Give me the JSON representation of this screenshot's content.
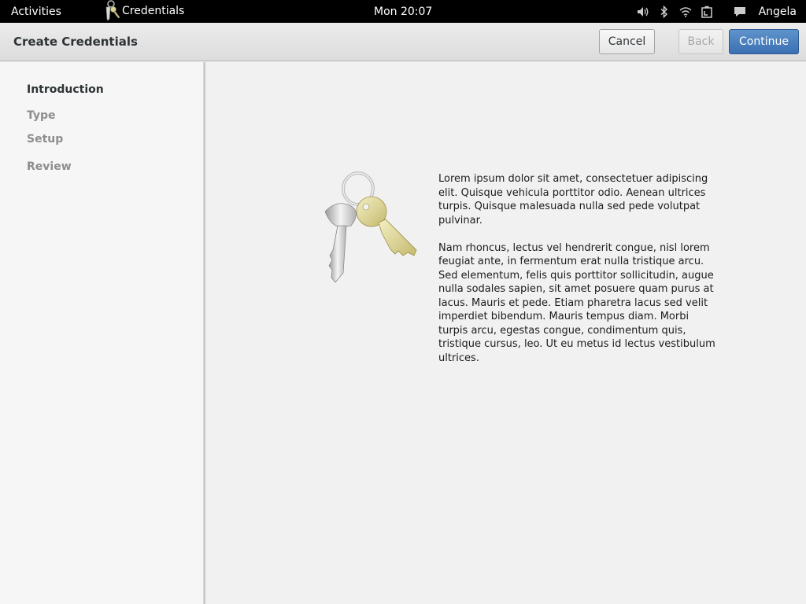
{
  "top_panel": {
    "activities_label": "Activities",
    "app_name": "Credentials",
    "clock": "Mon 20:07",
    "user_name": "Angela",
    "status_icons": [
      "volume-icon",
      "bluetooth-icon",
      "wifi-icon",
      "battery-icon",
      "chat-icon"
    ]
  },
  "header": {
    "title": "Create Credentials",
    "cancel_label": "Cancel",
    "back_label": "Back",
    "continue_label": "Continue",
    "accent_color": "#3a70b3"
  },
  "sidebar": {
    "steps": [
      {
        "label": "Introduction",
        "active": true
      },
      {
        "label": "Type",
        "active": false
      },
      {
        "label": "Setup",
        "active": false
      },
      {
        "label": "Review",
        "active": false
      }
    ]
  },
  "main": {
    "illustration": "keys-icon",
    "paragraphs": [
      "Lorem ipsum dolor sit amet, consectetuer adipiscing elit. Quisque vehicula porttitor odio. Aenean ultrices turpis. Quisque malesuada nulla sed pede volutpat pulvinar.",
      "Nam rhoncus, lectus vel hendrerit congue, nisl lorem feugiat ante, in fermentum erat nulla tristique arcu. Sed elementum, felis quis porttitor sollicitudin, augue nulla sodales sapien, sit amet posuere quam purus at lacus. Mauris et pede. Etiam pharetra lacus sed velit imperdiet bibendum. Mauris tempus diam. Morbi turpis arcu, egestas congue, condimentum quis, tristique cursus, leo. Ut eu metus id lectus vestibulum ultrices."
    ]
  }
}
